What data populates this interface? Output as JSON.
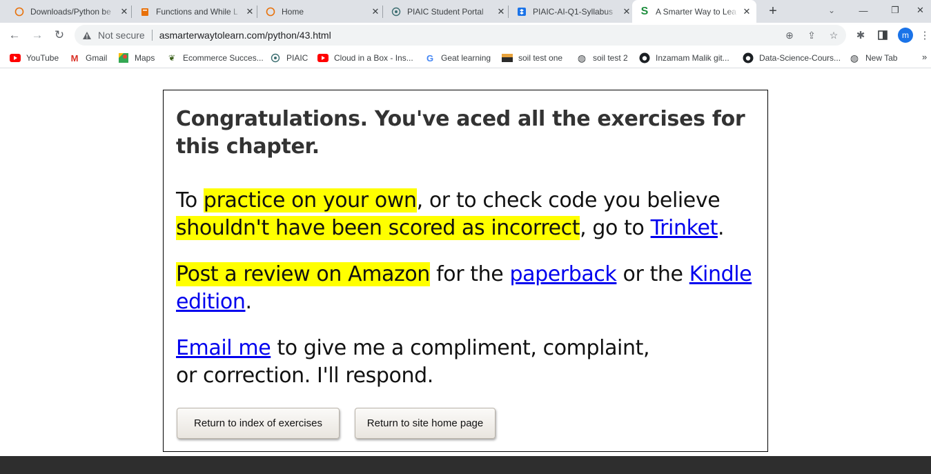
{
  "browser": {
    "tabs": [
      {
        "title": "Downloads/Python be",
        "icon": "loading-ring-icon"
      },
      {
        "title": "Functions and While L",
        "icon": "book-icon"
      },
      {
        "title": "Home",
        "icon": "loading-ring-icon"
      },
      {
        "title": "PIAIC Student Portal",
        "icon": "piaic-logo-icon"
      },
      {
        "title": "PIAIC-AI-Q1-Syllabus",
        "icon": "dropbox-icon"
      },
      {
        "title": "A Smarter Way to Lea",
        "icon": "s-logo-icon",
        "active": true
      }
    ],
    "address_bar": {
      "security_label": "Not secure",
      "url": "asmarterwaytolearn.com/python/43.html"
    },
    "profile_initial": "m",
    "bookmarks": [
      {
        "label": "YouTube",
        "icon": "youtube-icon"
      },
      {
        "label": "Gmail",
        "icon": "gmail-icon"
      },
      {
        "label": "Maps",
        "icon": "maps-icon"
      },
      {
        "label": "Ecommerce Succes...",
        "icon": "ecommerce-icon"
      },
      {
        "label": "PIAIC",
        "icon": "piaic-logo-icon"
      },
      {
        "label": "Cloud in a Box - Ins...",
        "icon": "youtube-icon"
      },
      {
        "label": "Geat learning",
        "icon": "google-icon"
      },
      {
        "label": "soil test one",
        "icon": "sts-icon"
      },
      {
        "label": "soil test 2",
        "icon": "globe-icon"
      },
      {
        "label": "Inzamam Malik git...",
        "icon": "github-icon"
      },
      {
        "label": "Data-Science-Cours...",
        "icon": "github-icon"
      },
      {
        "label": "New Tab",
        "icon": "globe-icon"
      }
    ],
    "colors": {
      "tabstrip": "#dee1e6",
      "highlight": "#ffff00",
      "link": "#0000ee",
      "footer": "#2e2e2e"
    }
  },
  "page": {
    "headline": "Congratulations. You've aced all the exercises for this chapter.",
    "practice": {
      "t1": "To ",
      "hl1": "practice on your own",
      "t2": ", or to check code you believe ",
      "hl2": "shouldn't have been scored as incorrect",
      "t3": ", go to ",
      "link": "Trinket",
      "t4": "."
    },
    "review": {
      "hl": "Post a review on Amazon",
      "t1": " for the ",
      "link1": "paperback",
      "t2": " or the ",
      "link2": "Kindle edition",
      "t3": "."
    },
    "email": {
      "link": "Email me",
      "t1": " to give me a compliment, complaint, or correction. I'll respond."
    },
    "buttons": {
      "index": "Return to index of exercises",
      "home": "Return to site home page"
    }
  }
}
